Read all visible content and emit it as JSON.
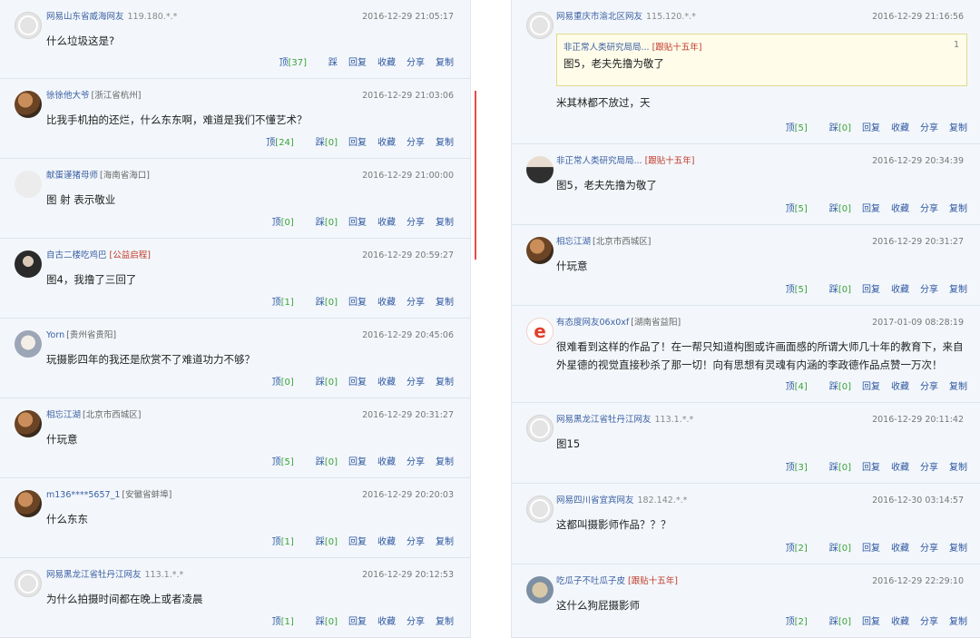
{
  "action_labels": {
    "up": "顶",
    "down": "踩",
    "reply": "回复",
    "fav": "收藏",
    "share": "分享",
    "copy": "复制"
  },
  "left_comments": [
    {
      "user": "网易山东省威海网友",
      "region": "",
      "ip": "119.180.*.*",
      "tag": "",
      "time": "2016-12-29 21:05:17",
      "text": "什么垃圾这是?",
      "up": "[37]",
      "down": "",
      "avatar": "default"
    },
    {
      "user": "徐徐他大爷",
      "region": "[浙江省杭州]",
      "ip": "",
      "tag": "",
      "time": "2016-12-29 21:03:06",
      "text": "比我手机拍的还烂，什么东东啊，难道是我们不懂艺术？",
      "up": "[24]",
      "down": "[0]",
      "avatar": "photo"
    },
    {
      "user": "献蛋谨猪母师",
      "region": "[海南省海口]",
      "ip": "",
      "tag": "",
      "time": "2016-12-29 21:00:00",
      "text": "图 射 表示敬业",
      "up": "[0]",
      "down": "[0]",
      "avatar": "blank"
    },
    {
      "user": "自古二楼吃鸡巴",
      "region": "",
      "ip": "",
      "tag": "[公益启程]",
      "time": "2016-12-29 20:59:27",
      "text": "图4，我撸了三回了",
      "up": "[1]",
      "down": "[0]",
      "avatar": "dark"
    },
    {
      "user": "Yorn",
      "region": "[贵州省贵阳]",
      "ip": "",
      "tag": "",
      "time": "2016-12-29 20:45:06",
      "text": "玩摄影四年的我还是欣赏不了难道功力不够？",
      "up": "[0]",
      "down": "[0]",
      "avatar": "cat"
    },
    {
      "user": "相忘江湖",
      "region": "[北京市西城区]",
      "ip": "",
      "tag": "",
      "time": "2016-12-29 20:31:27",
      "text": "什玩意",
      "up": "[5]",
      "down": "[0]",
      "avatar": "photo"
    },
    {
      "user": "m136****5657_1",
      "region": "[安徽省蚌埠]",
      "ip": "",
      "tag": "",
      "time": "2016-12-29 20:20:03",
      "text": "什么东东",
      "up": "[1]",
      "down": "[0]",
      "avatar": "photo"
    },
    {
      "user": "网易黑龙江省牡丹江网友",
      "region": "",
      "ip": "113.1.*.*",
      "tag": "",
      "time": "2016-12-29 20:12:53",
      "text": "为什么拍摄时间都在晚上或者凌晨",
      "up": "[1]",
      "down": "[0]",
      "avatar": "default"
    }
  ],
  "right_comments": [
    {
      "user": "网易重庆市渝北区网友",
      "region": "",
      "ip": "115.120.*.*",
      "tag": "",
      "time": "2016-12-29 21:16:56",
      "quote": {
        "user": "非正常人类研究局局...",
        "tag": "[跟贴十五年]",
        "num": "1",
        "text": "图5，老夫先撸为敬了"
      },
      "text": "米其林都不放过，天",
      "up": "[5]",
      "down": "[0]",
      "avatar": "default"
    },
    {
      "user": "非正常人类研究局局...",
      "region": "",
      "ip": "",
      "tag": "[跟贴十五年]",
      "time": "2016-12-29 20:34:39",
      "text": "图5，老夫先撸为敬了",
      "up": "[5]",
      "down": "[0]",
      "avatar": "person"
    },
    {
      "user": "相忘江湖",
      "region": "[北京市西城区]",
      "ip": "",
      "tag": "",
      "time": "2016-12-29 20:31:27",
      "text": "什玩意",
      "up": "[5]",
      "down": "[0]",
      "avatar": "photo"
    },
    {
      "user": "有态度网友06x0xf",
      "region": "[湖南省益阳]",
      "ip": "",
      "tag": "",
      "time": "2017-01-09 08:28:19",
      "text": "很难看到这样的作品了！在一帮只知道构图或许画面感的所谓大师几十年的教育下，来自外星德的视觉直接秒杀了那一切！向有思想有灵魂有内涵的李政德作品点赞一万次！",
      "up": "[4]",
      "down": "[0]",
      "avatar": "wheel"
    },
    {
      "user": "网易黑龙江省牡丹江网友",
      "region": "",
      "ip": "113.1.*.*",
      "tag": "",
      "time": "2016-12-29 20:11:42",
      "text": "图15",
      "up": "[3]",
      "down": "[0]",
      "avatar": "default"
    },
    {
      "user": "网易四川省宜宾网友",
      "region": "",
      "ip": "182.142.*.*",
      "tag": "",
      "time": "2016-12-30 03:14:57",
      "text": "这都叫摄影师作品？？？",
      "up": "[2]",
      "down": "[0]",
      "avatar": "default"
    },
    {
      "user": "吃瓜子不吐瓜子皮",
      "region": "",
      "ip": "",
      "tag": "[跟贴十五年]",
      "time": "2016-12-29 22:29:10",
      "text": "这什么狗屁摄影师",
      "up": "[2]",
      "down": "[0]",
      "avatar": "dog"
    }
  ]
}
